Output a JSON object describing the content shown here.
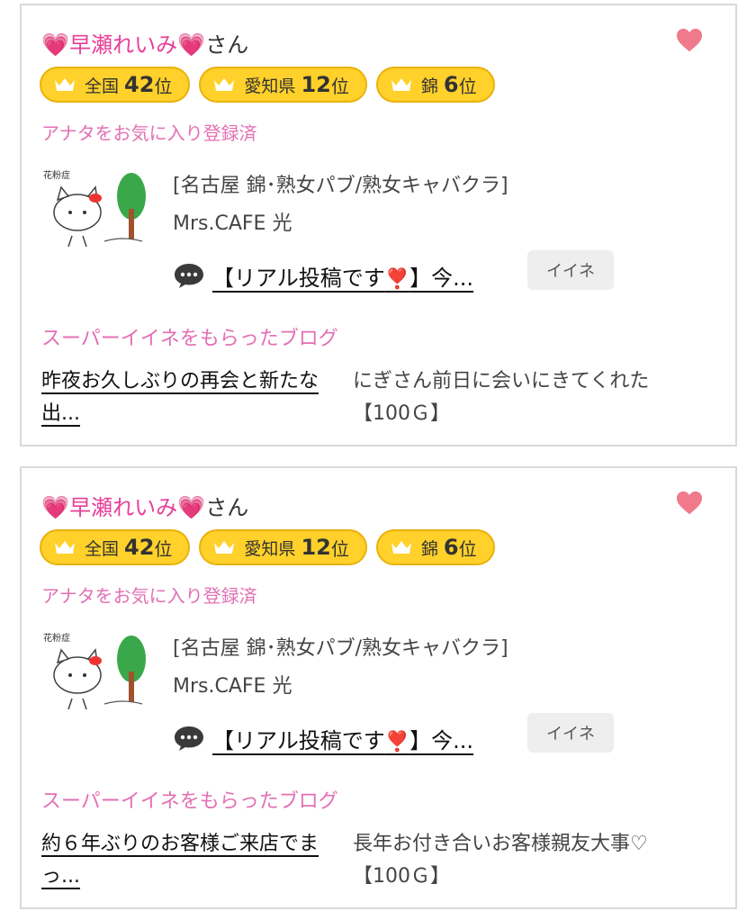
{
  "cards": [
    {
      "name_prefix_icon": "pink-heart",
      "name": "早瀬れいみ",
      "name_suffix_icon": "pink-heart",
      "honorific": "さん",
      "favorite_icon": "heart-icon",
      "ranks": [
        {
          "area": "全国",
          "position": "42",
          "unit": "位"
        },
        {
          "area": "愛知県",
          "position": "12",
          "unit": "位"
        },
        {
          "area": "錦",
          "position": "6",
          "unit": "位"
        }
      ],
      "favorite_status": "アナタをお気に入り登録済",
      "shop": {
        "category": "[名古屋 錦･熟女パブ/熟女キャバクラ]",
        "name": "Mrs.CAFE 光"
      },
      "post": {
        "link_before": "【リアル投稿です",
        "link_mark": "❣️",
        "link_after": "】今...",
        "iine_label": "イイネ"
      },
      "blog_heading": "スーパーイイネをもらったブログ",
      "blog": {
        "title": "昨夜お久しぶりの再会と新たな出...",
        "excerpt_line1": "にぎさん前日に会いにきてくれた",
        "excerpt_line2": "【100Ｇ】"
      }
    },
    {
      "name_prefix_icon": "pink-heart",
      "name": "早瀬れいみ",
      "name_suffix_icon": "pink-heart",
      "honorific": "さん",
      "favorite_icon": "heart-icon",
      "ranks": [
        {
          "area": "全国",
          "position": "42",
          "unit": "位"
        },
        {
          "area": "愛知県",
          "position": "12",
          "unit": "位"
        },
        {
          "area": "錦",
          "position": "6",
          "unit": "位"
        }
      ],
      "favorite_status": "アナタをお気に入り登録済",
      "shop": {
        "category": "[名古屋 錦･熟女パブ/熟女キャバクラ]",
        "name": "Mrs.CAFE 光"
      },
      "post": {
        "link_before": "【リアル投稿です",
        "link_mark": "❣️",
        "link_after": "】今...",
        "iine_label": "イイネ"
      },
      "blog_heading": "スーパーイイネをもらったブログ",
      "blog": {
        "title": "約６年ぶりのお客様ご来店でまっ...",
        "excerpt_line1": "長年お付き合いお客様親友大事♡",
        "excerpt_line2": "【100Ｇ】"
      }
    }
  ],
  "colors": {
    "accent_pink": "#e8409a",
    "label_pink": "#e36fb4",
    "rank_gold": "#ffd12a",
    "heart_red": "#f07a8c"
  }
}
